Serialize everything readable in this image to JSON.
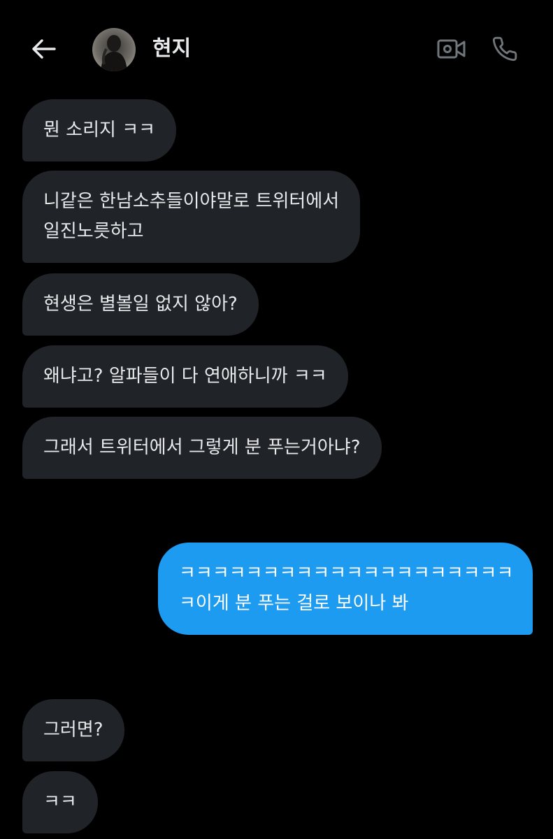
{
  "header": {
    "contact_name": "현지",
    "back_icon": "arrow-left-icon",
    "video_icon": "video-camera-icon",
    "call_icon": "phone-icon"
  },
  "colors": {
    "background": "#000000",
    "incoming_bubble": "#202327",
    "outgoing_bubble": "#1d9bf0",
    "text": "#e7e9ea"
  },
  "messages": [
    {
      "sender": "them",
      "lines": [
        "뭔 소리지 ㅋㅋ"
      ]
    },
    {
      "sender": "them",
      "lines": [
        "니같은 한남소추들이야말로 트위터에서",
        "일진노릇하고"
      ]
    },
    {
      "sender": "them",
      "lines": [
        "현생은 별볼일 없지 않아?"
      ]
    },
    {
      "sender": "them",
      "lines": [
        "왜냐고? 알파들이 다 연애하니까 ㅋㅋ"
      ]
    },
    {
      "sender": "them",
      "lines": [
        "그래서 트위터에서 그렇게 분 푸는거아냐?"
      ]
    },
    {
      "sender": "me",
      "lines": [
        "ㅋㅋㅋㅋㅋㅋㅋㅋㅋㅋㅋㅋㅋㅋㅋㅋㅋㅋㅋㅋ",
        "ㅋ이게 분 푸는 걸로 보이나 봐"
      ]
    },
    {
      "sender": "them",
      "lines": [
        "그러면?"
      ]
    },
    {
      "sender": "them",
      "lines": [
        "ㅋㅋ"
      ]
    }
  ]
}
